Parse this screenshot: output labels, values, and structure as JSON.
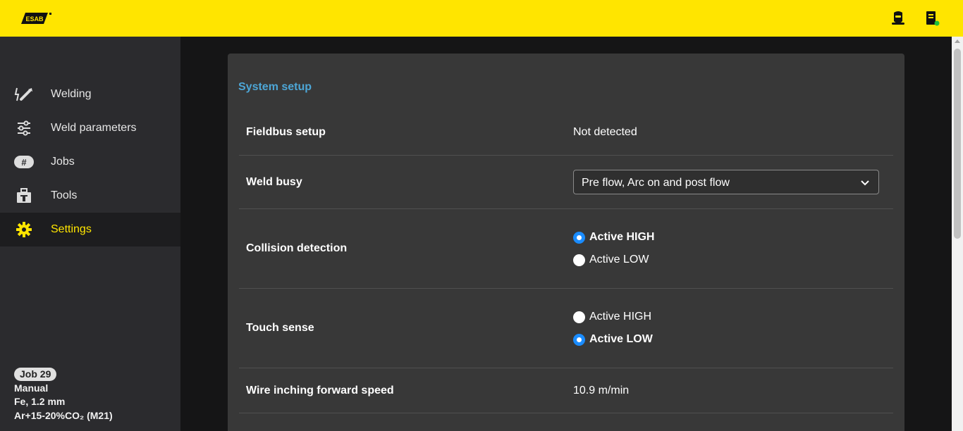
{
  "brand": {
    "logo_text": "ESAB",
    "accent": "#ffe500",
    "link_color": "#4da6d6",
    "radio_checked": "#1a8cff"
  },
  "topbar": {
    "icons": [
      "welder-mask-icon",
      "device-connected-icon"
    ]
  },
  "sidebar": {
    "items": [
      {
        "label": "Welding",
        "icon": "welding-torch-icon",
        "active": false
      },
      {
        "label": "Weld parameters",
        "icon": "sliders-icon",
        "active": false
      },
      {
        "label": "Jobs",
        "icon": "hash-icon",
        "active": false
      },
      {
        "label": "Tools",
        "icon": "toolbox-icon",
        "active": false
      },
      {
        "label": "Settings",
        "icon": "gear-icon",
        "active": true
      }
    ],
    "job": {
      "badge": "Job 29",
      "mode": "Manual",
      "material": "Fe, 1.2 mm",
      "gas": "Ar+15-20%CO₂ (M21)"
    }
  },
  "content": {
    "section_title": "System setup",
    "rows": {
      "fieldbus": {
        "label": "Fieldbus setup",
        "value": "Not detected"
      },
      "weld_busy": {
        "label": "Weld busy",
        "selected": "Pre flow, Arc on and post flow"
      },
      "collision": {
        "label": "Collision detection",
        "options": [
          "Active HIGH",
          "Active LOW"
        ],
        "selected": "Active HIGH"
      },
      "touch": {
        "label": "Touch sense",
        "options": [
          "Active HIGH",
          "Active LOW"
        ],
        "selected": "Active LOW"
      },
      "wire": {
        "label": "Wire inching forward speed",
        "value": "10.9 m/min"
      }
    }
  }
}
